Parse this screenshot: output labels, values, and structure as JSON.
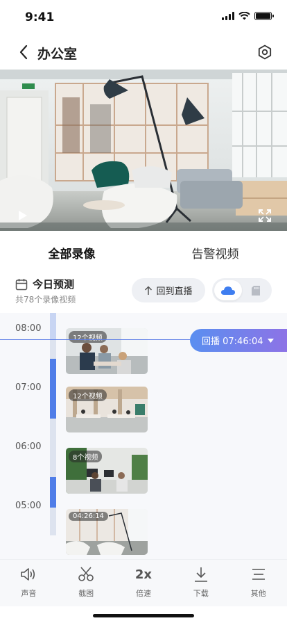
{
  "status": {
    "time": "9:41"
  },
  "nav": {
    "title": "办公室"
  },
  "tabs": [
    {
      "label": "全部录像",
      "active": true
    },
    {
      "label": "告警视频",
      "active": false
    }
  ],
  "records": {
    "title": "今日预测",
    "subtitle": "共78个录像视频",
    "live_button": "回到直播",
    "storage": {
      "selected": "cloud",
      "options": [
        "cloud-icon",
        "sd-card-icon"
      ]
    }
  },
  "timeline": {
    "labels": [
      "08:00",
      "07:00",
      "06:00",
      "05:00"
    ],
    "clips": [
      {
        "badge": "12个视频"
      },
      {
        "badge": "12个视频"
      },
      {
        "badge": "8个视频"
      },
      {
        "badge": "04:26:14"
      }
    ],
    "playback": "回播 07:46:04"
  },
  "toolbar": [
    {
      "icon": "speaker-icon",
      "label": "声音"
    },
    {
      "icon": "scissors-icon",
      "label": "截图"
    },
    {
      "icon": "speed-icon",
      "label": "倍速",
      "glyph": "2x"
    },
    {
      "icon": "download-icon",
      "label": "下载"
    },
    {
      "icon": "menu-icon",
      "label": "其他"
    }
  ],
  "colors": {
    "accent": "#4f7de8",
    "track": "#dde3ef",
    "playback_start": "#5a8ff0",
    "playback_end": "#8d73e6"
  }
}
